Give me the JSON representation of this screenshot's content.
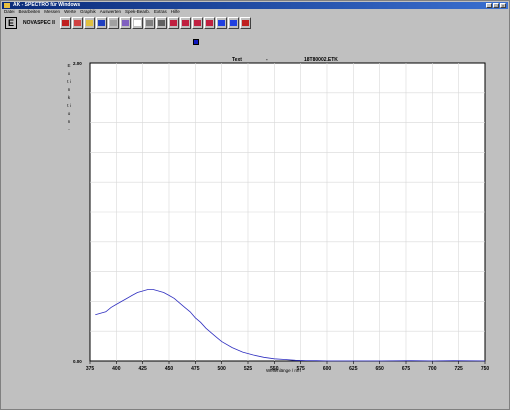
{
  "window": {
    "title": "AK - SPECTRO für Windows",
    "controls": [
      "_",
      "□",
      "×"
    ]
  },
  "menu": [
    "Datei",
    "Bearbeiten",
    "Messen",
    "Werte",
    "Graphik",
    "Auswerten",
    "Spek-Bearb.",
    "Extras",
    "Hilfe"
  ],
  "toolbar": {
    "instrument_button": "E",
    "instrument_name": "NOVASPEC II",
    "buttons": [
      {
        "name": "measure-icon",
        "color": "#c02020"
      },
      {
        "name": "scan-icon",
        "color": "#d04040"
      },
      {
        "name": "open-icon",
        "color": "#e0c040"
      },
      {
        "name": "save-icon",
        "color": "#2040c0"
      },
      {
        "name": "tools-icon",
        "color": "#a0a0a0"
      },
      {
        "name": "edit-icon",
        "color": "#8060c0"
      },
      {
        "name": "abc-icon",
        "color": "#ffffff"
      },
      {
        "name": "print-icon",
        "color": "#808080"
      },
      {
        "name": "table-icon",
        "color": "#606060"
      },
      {
        "name": "peaks-icon",
        "color": "#c02040"
      },
      {
        "name": "peaks2-icon",
        "color": "#c02040"
      },
      {
        "name": "area-icon",
        "color": "#c02040"
      },
      {
        "name": "spectrum-icon",
        "color": "#c02040"
      },
      {
        "name": "opt-icon",
        "color": "#2040e0"
      },
      {
        "name": "ok-icon",
        "color": "#2040e0"
      },
      {
        "name": "exit-icon",
        "color": "#c02020"
      }
    ]
  },
  "info": {
    "text_label": "Text",
    "separator": "-",
    "filename": "18T80002.ETK"
  },
  "chart_data": {
    "type": "line",
    "ylabel": "E x t i n k t i o n",
    "ylabel_suffix": "-",
    "ylabel_unit": "",
    "xlabel": "Wellenlänge / nm",
    "xlim": [
      375,
      750
    ],
    "ylim": [
      0.0,
      2.0
    ],
    "x_ticks": [
      375,
      400,
      425,
      450,
      475,
      500,
      525,
      550,
      575,
      600,
      625,
      650,
      675,
      700,
      725,
      750
    ],
    "y_tick_labels": [
      "2.00",
      "0.00"
    ],
    "grid": true,
    "series_color": "#3030c0",
    "series": [
      {
        "x": [
          380,
          385,
          390,
          395,
          400,
          405,
          410,
          415,
          420,
          425,
          430,
          435,
          440,
          445,
          450,
          455,
          460,
          465,
          470,
          475,
          480,
          485,
          490,
          495,
          500,
          510,
          520,
          530,
          540,
          550,
          560,
          570,
          580,
          590,
          600,
          620,
          650,
          680,
          700,
          720,
          750
        ],
        "y": [
          0.31,
          0.32,
          0.33,
          0.36,
          0.38,
          0.4,
          0.42,
          0.44,
          0.46,
          0.47,
          0.48,
          0.48,
          0.47,
          0.46,
          0.44,
          0.42,
          0.39,
          0.36,
          0.33,
          0.29,
          0.26,
          0.22,
          0.19,
          0.16,
          0.13,
          0.09,
          0.06,
          0.04,
          0.025,
          0.015,
          0.01,
          0.005,
          0.003,
          0.002,
          0.001,
          0.001,
          0.001,
          0.002,
          0.001,
          0.002,
          0.001
        ]
      }
    ]
  }
}
